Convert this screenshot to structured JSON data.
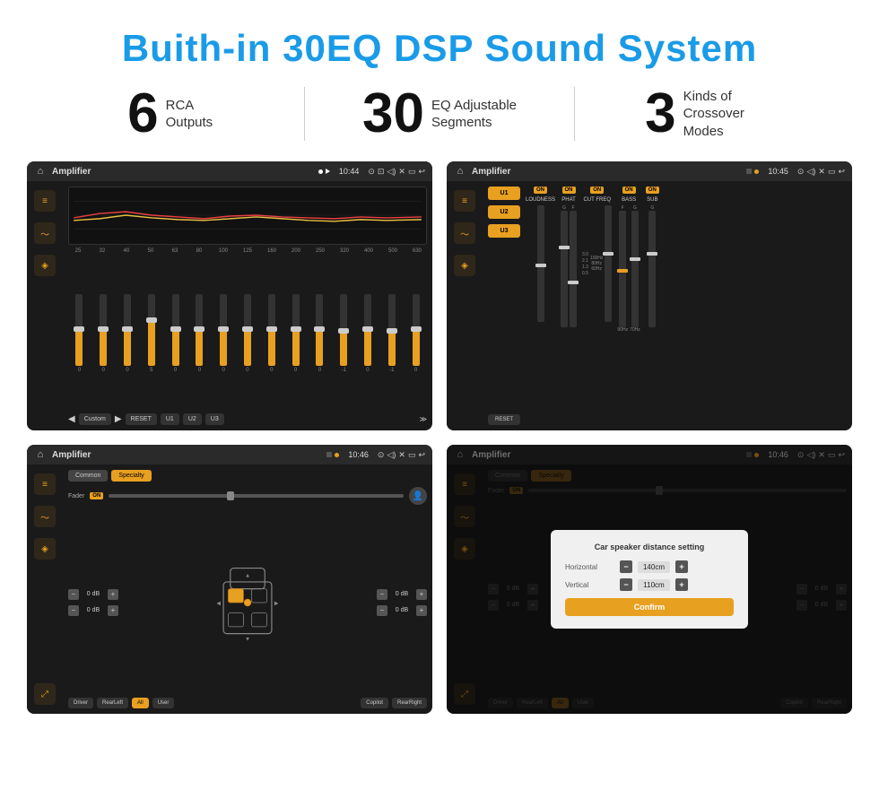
{
  "page": {
    "title": "Buith-in 30EQ DSP Sound System",
    "background": "#ffffff"
  },
  "stats": [
    {
      "number": "6",
      "label": "RCA\nOutputs"
    },
    {
      "number": "30",
      "label": "EQ Adjustable\nSegments"
    },
    {
      "number": "3",
      "label": "Kinds of\nCrossover Modes"
    }
  ],
  "screens": [
    {
      "id": "screen1",
      "status": {
        "app": "Amplifier",
        "time": "10:44"
      },
      "type": "eq",
      "eq_frequencies": [
        "25",
        "32",
        "40",
        "50",
        "63",
        "80",
        "100",
        "125",
        "160",
        "200",
        "250",
        "320",
        "400",
        "500",
        "630"
      ],
      "eq_values": [
        "0",
        "0",
        "0",
        "5",
        "0",
        "0",
        "0",
        "0",
        "0",
        "0",
        "0",
        "-1",
        "0",
        "-1"
      ],
      "preset_label": "Custom",
      "buttons": [
        "RESET",
        "U1",
        "U2",
        "U3"
      ]
    },
    {
      "id": "screen2",
      "status": {
        "app": "Amplifier",
        "time": "10:45"
      },
      "type": "crossover",
      "presets": [
        "U1",
        "U2",
        "U3"
      ],
      "channels": [
        {
          "name": "LOUDNESS",
          "on": true
        },
        {
          "name": "PHAT",
          "on": true
        },
        {
          "name": "CUT FREQ",
          "on": true
        },
        {
          "name": "BASS",
          "on": true
        },
        {
          "name": "SUB",
          "on": true
        }
      ],
      "reset_label": "RESET"
    },
    {
      "id": "screen3",
      "status": {
        "app": "Amplifier",
        "time": "10:46"
      },
      "type": "speaker",
      "tabs": [
        "Common",
        "Specialty"
      ],
      "active_tab": "Specialty",
      "fader_label": "Fader",
      "fader_on": true,
      "volume_rows": [
        {
          "label": "0 dB"
        },
        {
          "label": "0 dB"
        }
      ],
      "volume_rows_right": [
        {
          "label": "0 dB"
        },
        {
          "label": "0 dB"
        }
      ],
      "bottom_buttons": [
        "Driver",
        "RearLeft",
        "All",
        "User",
        "Copilot",
        "RearRight"
      ]
    },
    {
      "id": "screen4",
      "status": {
        "app": "Amplifier",
        "time": "10:46"
      },
      "type": "speaker_dialog",
      "tabs": [
        "Common",
        "Specialty"
      ],
      "dialog": {
        "title": "Car speaker distance setting",
        "horizontal_label": "Horizontal",
        "horizontal_value": "140cm",
        "vertical_label": "Vertical",
        "vertical_value": "110cm",
        "confirm_label": "Confirm"
      },
      "bottom_buttons": [
        "Driver",
        "RearLeft",
        "All",
        "User",
        "Copilot",
        "RearRight"
      ]
    }
  ],
  "icons": {
    "home": "⌂",
    "music": "♫",
    "wave": "〜",
    "speaker": "◈",
    "eq": "≡",
    "back": "↩",
    "location": "⊙",
    "camera": "⊡",
    "volume": "◁)",
    "close": "✕",
    "window": "▭",
    "minus": "−",
    "plus": "+",
    "arrow_left": "◀",
    "arrow_right": "▶",
    "arrow_up": "▲",
    "arrow_down": "▼",
    "person": "👤",
    "car": "🚗"
  }
}
